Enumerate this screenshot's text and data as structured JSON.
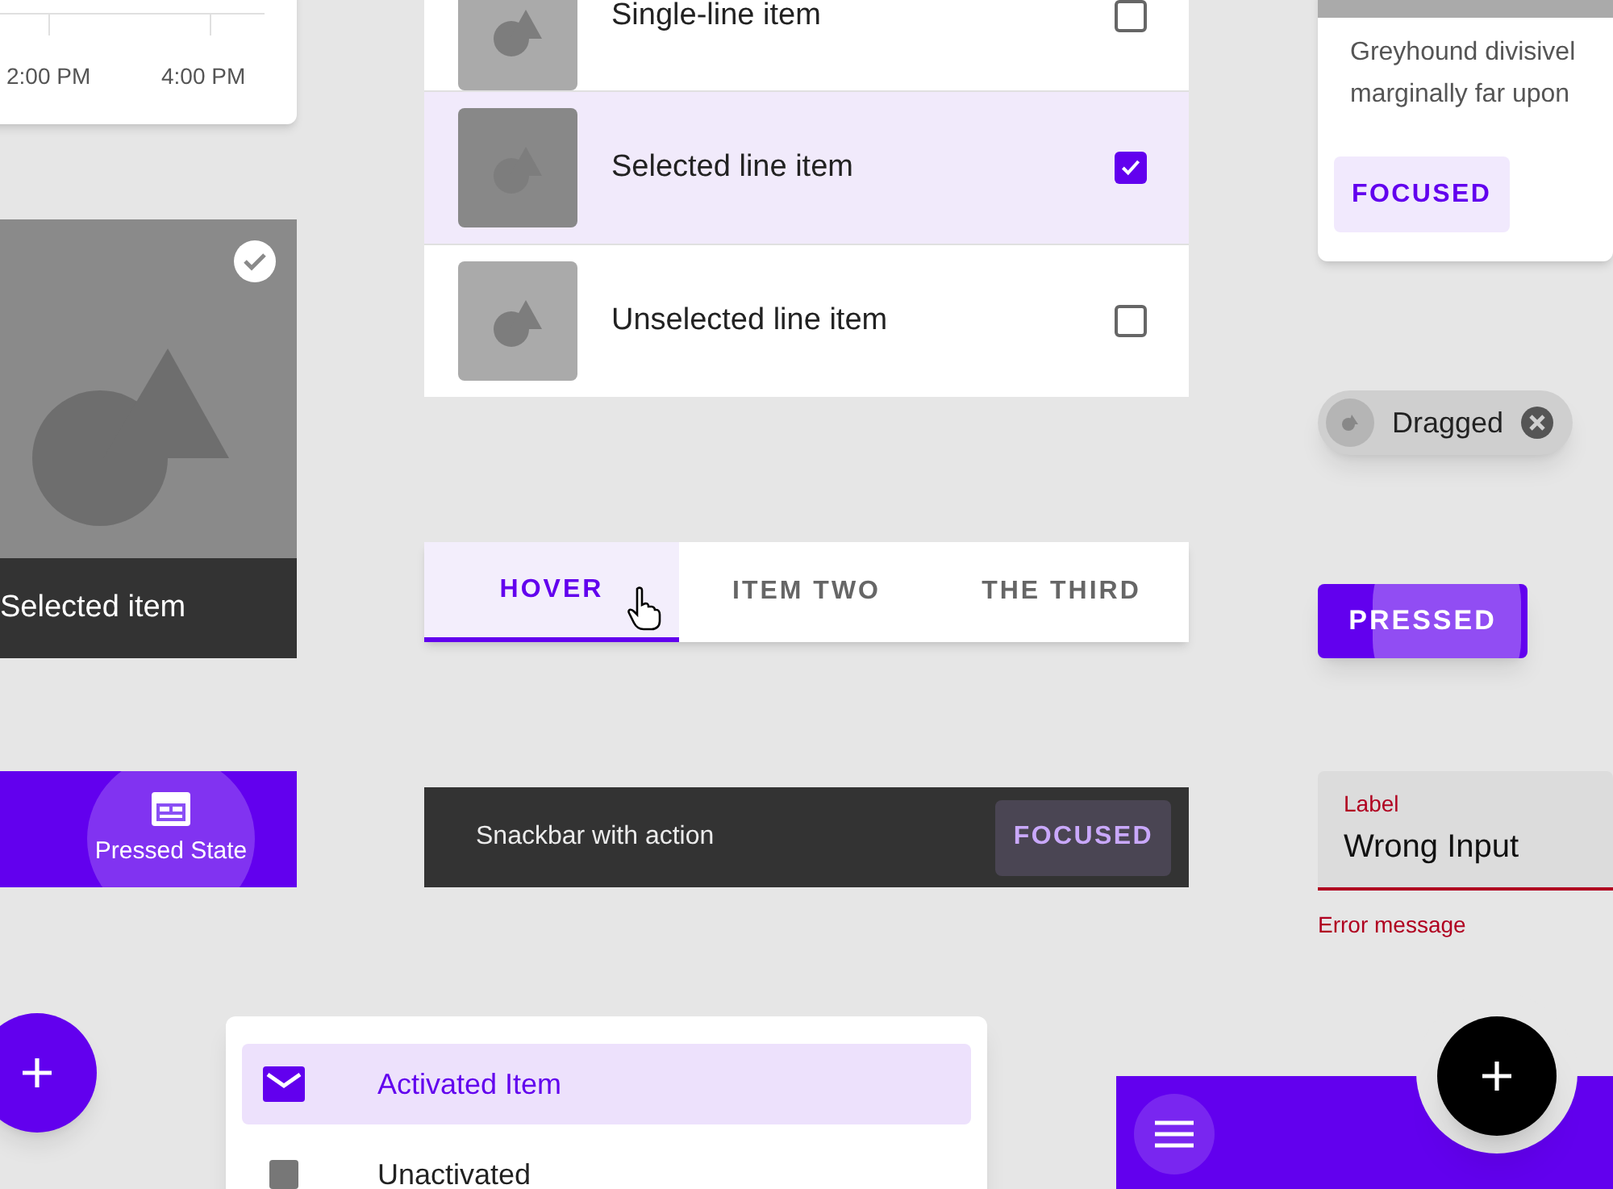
{
  "chart_card": {
    "x_labels": [
      "2:00 PM",
      "4:00 PM"
    ]
  },
  "image_list": {
    "items": [
      {
        "label": "Single-line item",
        "selected": false
      },
      {
        "label": "Selected line item",
        "selected": true
      },
      {
        "label": "Unselected line item",
        "selected": false
      }
    ]
  },
  "image_tile": {
    "label": "Selected item",
    "selected": true
  },
  "tabs": [
    {
      "label": "HOVER",
      "selected": true
    },
    {
      "label": "ITEM TWO",
      "selected": false
    },
    {
      "label": "THE THIRD",
      "selected": false
    }
  ],
  "snackbar": {
    "message": "Snackbar with action",
    "action": "FOCUSED"
  },
  "bottom_nav": {
    "items": [
      {
        "label": "Pressed State",
        "selected": true
      }
    ]
  },
  "card": {
    "lines": [
      "Greyhound divisivel",
      "marginally far upon"
    ],
    "button": "FOCUSED"
  },
  "chip": {
    "label": "Dragged"
  },
  "button": {
    "label": "PRESSED"
  },
  "text_field": {
    "label": "Label",
    "value": "Wrong Input",
    "error": "Error message"
  },
  "nav_drawer": {
    "items": [
      {
        "label": "Activated Item",
        "selected": true
      },
      {
        "label": "Unactivated",
        "selected": false
      }
    ]
  }
}
